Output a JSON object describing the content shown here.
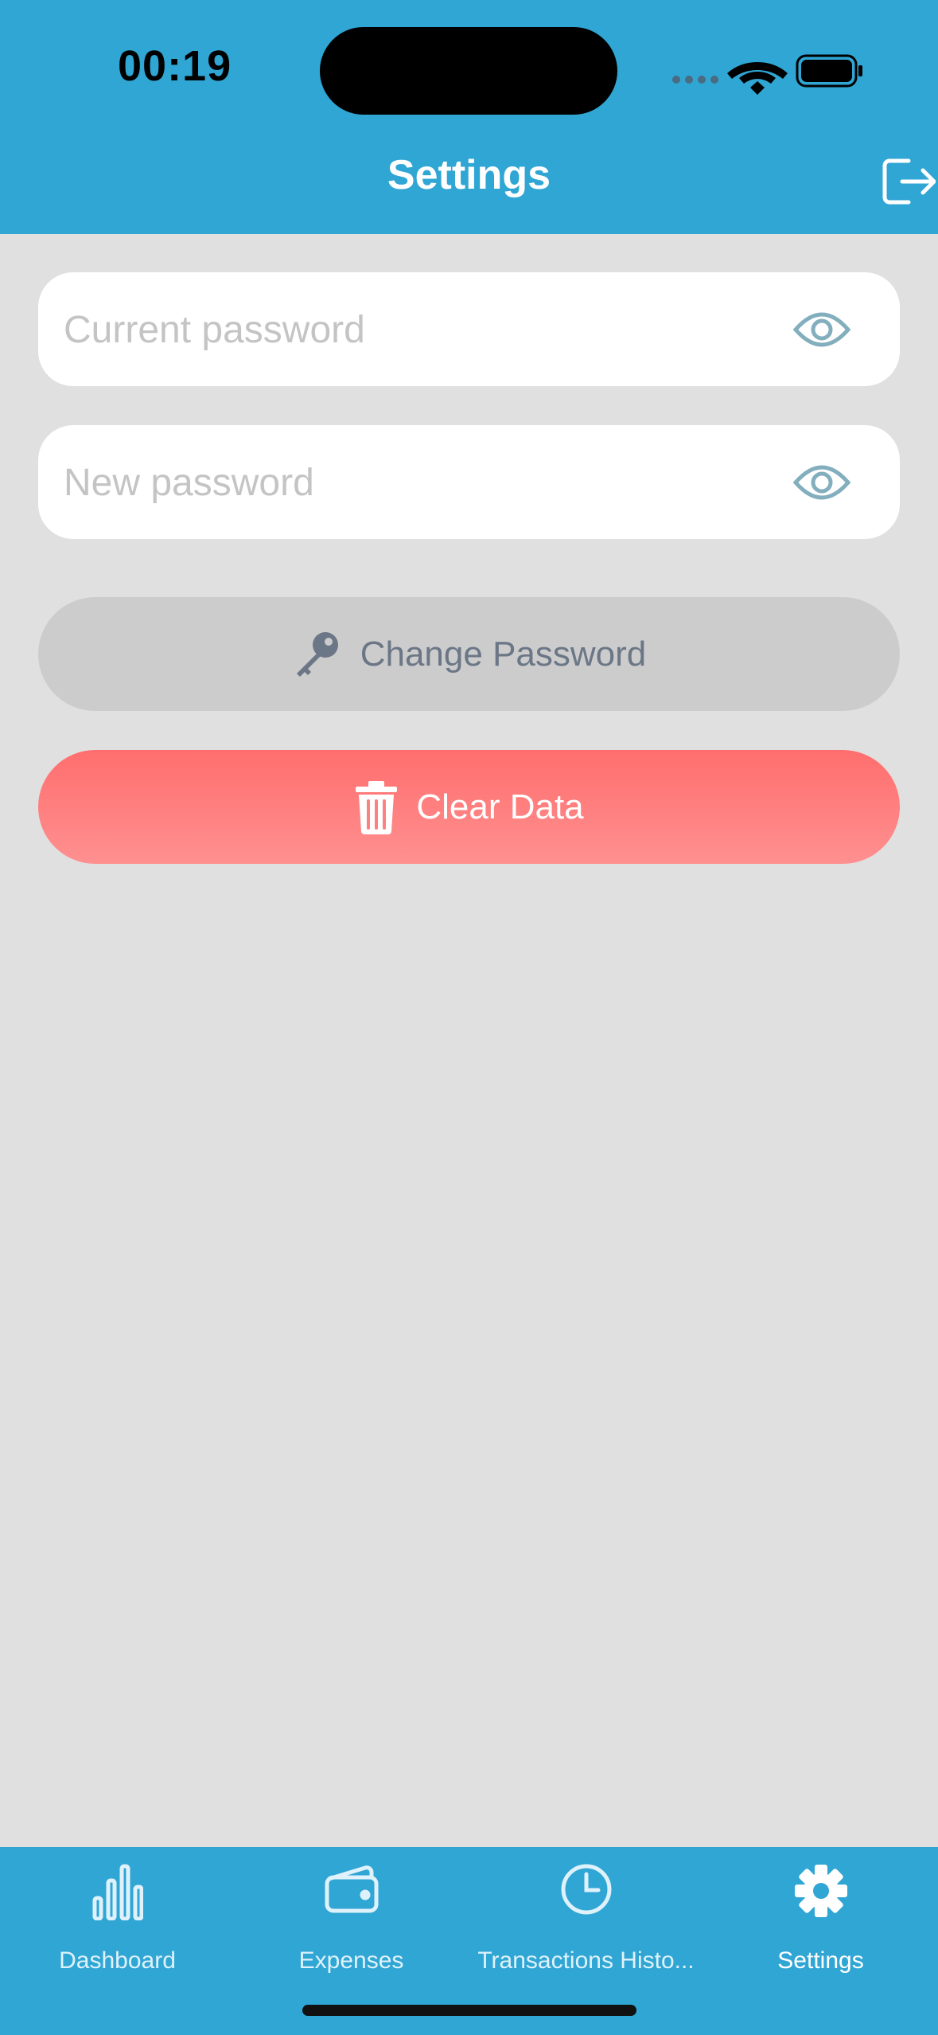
{
  "status_bar": {
    "time": "00:19"
  },
  "header": {
    "title": "Settings",
    "logout_icon": "logout-icon"
  },
  "form": {
    "current_password": {
      "placeholder": "Current password",
      "value": ""
    },
    "new_password": {
      "placeholder": "New password",
      "value": ""
    }
  },
  "actions": {
    "change_password_label": "Change Password",
    "clear_data_label": "Clear Data"
  },
  "tabs": [
    {
      "label": "Dashboard",
      "icon": "bar-chart-icon"
    },
    {
      "label": "Expenses",
      "icon": "wallet-icon"
    },
    {
      "label": "Transactions Histo...",
      "icon": "clock-icon"
    },
    {
      "label": "Settings",
      "icon": "gear-icon",
      "active": true
    }
  ],
  "colors": {
    "header": "#30a6d4",
    "background": "#e0e0e0",
    "clear_button": "#ff7a7a",
    "change_button": "#cccccc"
  }
}
